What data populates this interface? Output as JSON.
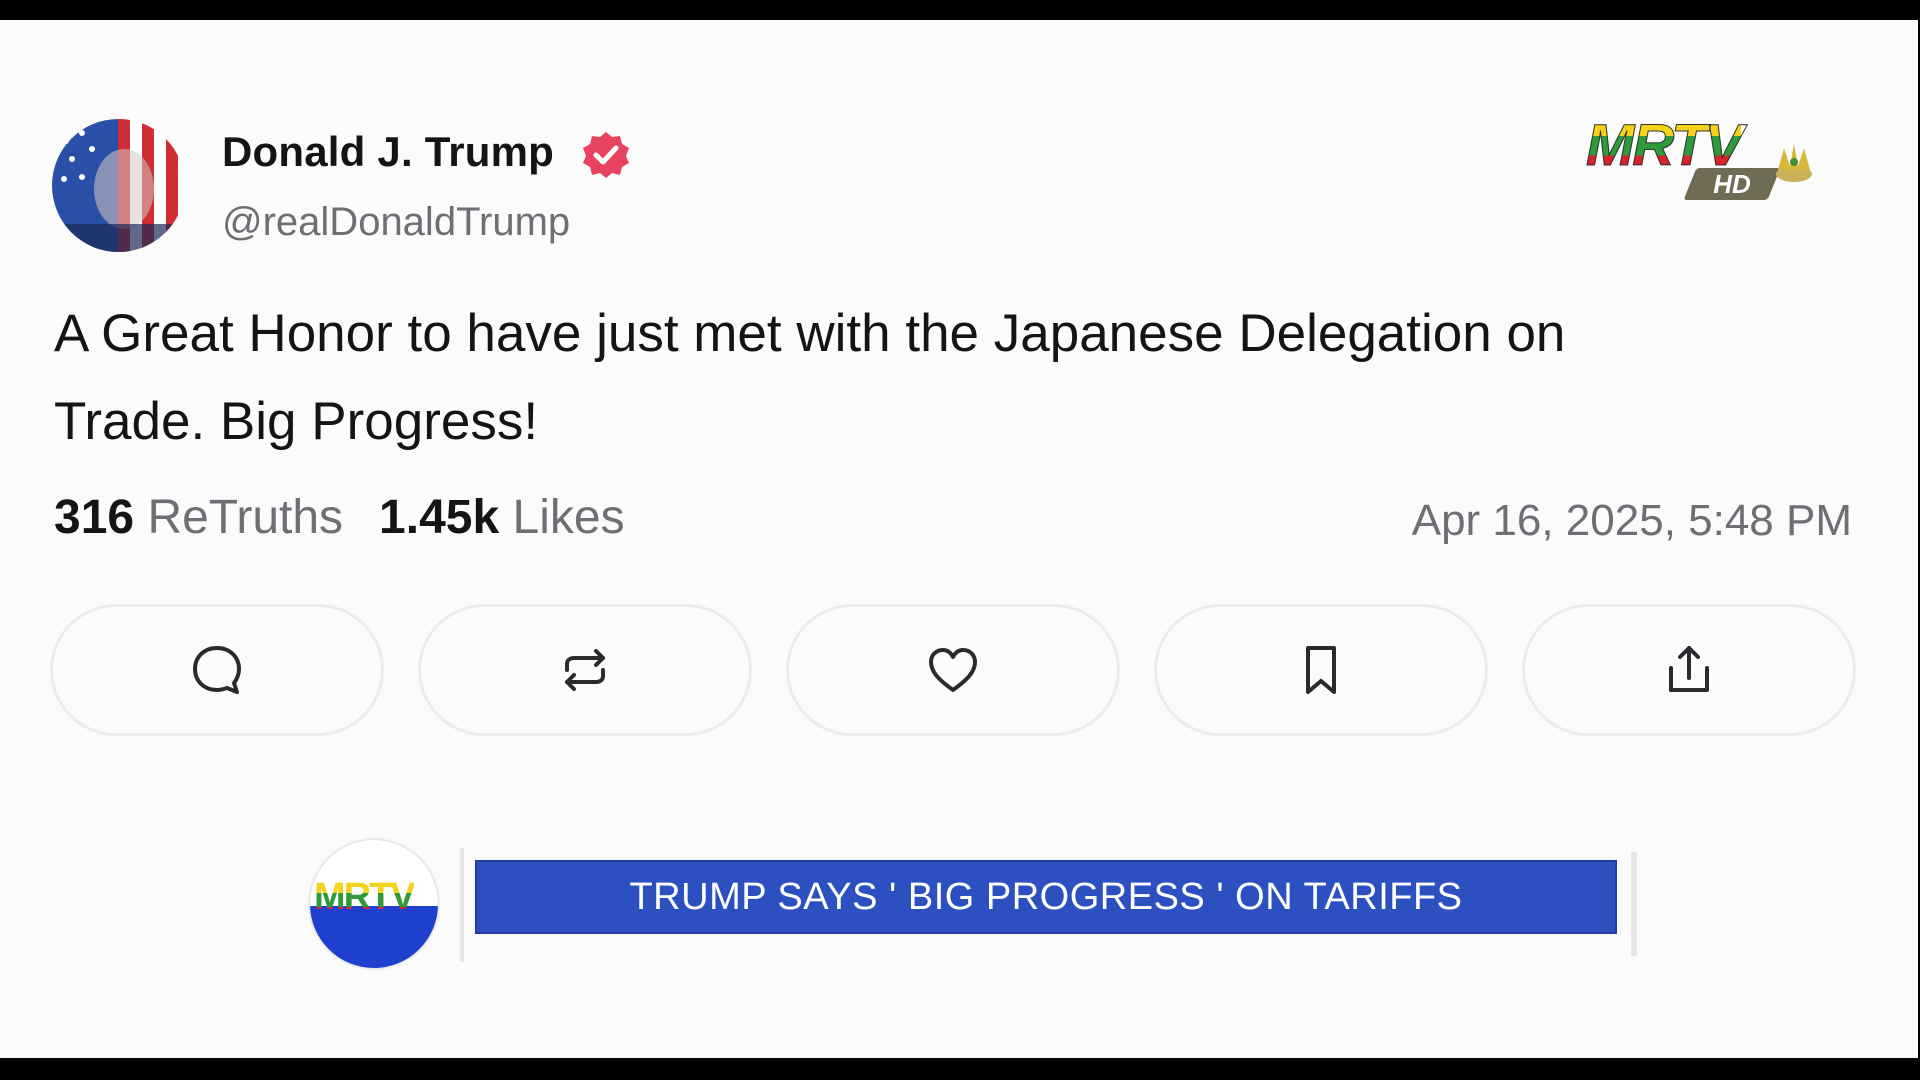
{
  "post": {
    "display_name": "Donald J. Trump",
    "handle": "@realDonaldTrump",
    "text_lines": [
      "A Great Honor to have just met with the Japanese Delegation on",
      "Trade. Big Progress!"
    ],
    "retruths_count": "316",
    "retruths_label": "ReTruths",
    "likes_count": "1.45k",
    "likes_label": "Likes",
    "timestamp": "Apr 16, 2025, 5:48 PM",
    "verified_color": "#e8445f"
  },
  "actions": [
    {
      "name": "reply",
      "icon": "comment-icon"
    },
    {
      "name": "retruth",
      "icon": "repost-icon"
    },
    {
      "name": "like",
      "icon": "heart-icon"
    },
    {
      "name": "bookmark",
      "icon": "bookmark-icon"
    },
    {
      "name": "share",
      "icon": "share-icon"
    }
  ],
  "broadcast": {
    "logo_text": "MRTV",
    "logo_badge": "HD",
    "ticker_logo_text": "MRTV",
    "headline": "TRUMP SAYS ' BIG PROGRESS ' ON TARIFFS",
    "headline_bg": "#2d50c0"
  }
}
